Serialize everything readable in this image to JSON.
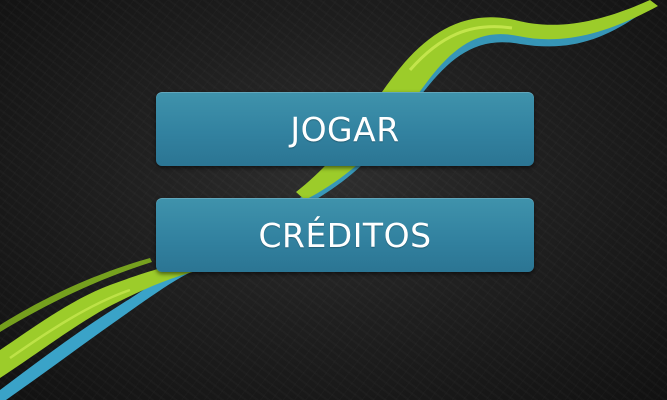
{
  "menu": {
    "play_label": "JOGAR",
    "credits_label": "CRÉDITOS"
  },
  "theme": {
    "background": "#1f1f1f",
    "button_color": "#3282a0",
    "ribbon_green": "#9ccc2a",
    "ribbon_blue": "#3aa3c8"
  }
}
